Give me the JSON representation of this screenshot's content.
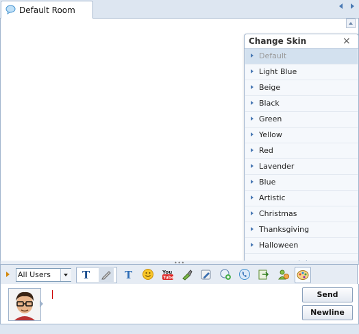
{
  "tab": {
    "title": "Default Room"
  },
  "skin_menu": {
    "title": "Change Skin",
    "close_symbol": "×",
    "selected": "Default",
    "items": [
      "Default",
      "Light Blue",
      "Beige",
      "Black",
      "Green",
      "Yellow",
      "Red",
      "Lavender",
      "Blue",
      "Artistic",
      "Christmas",
      "Thanksgiving",
      "Halloween"
    ]
  },
  "toolbar": {
    "user_filter": "All Users",
    "icons": [
      "text-style-icon",
      "pencil-icon",
      "font-color-icon",
      "emoticon-icon",
      "youtube-icon",
      "paint-icon",
      "edit-icon",
      "add-contact-icon",
      "call-icon",
      "export-icon",
      "users-icon",
      "skin-palette-icon"
    ]
  },
  "input": {
    "placeholder": "",
    "value": ""
  },
  "buttons": {
    "send": "Send",
    "newline": "Newline"
  }
}
